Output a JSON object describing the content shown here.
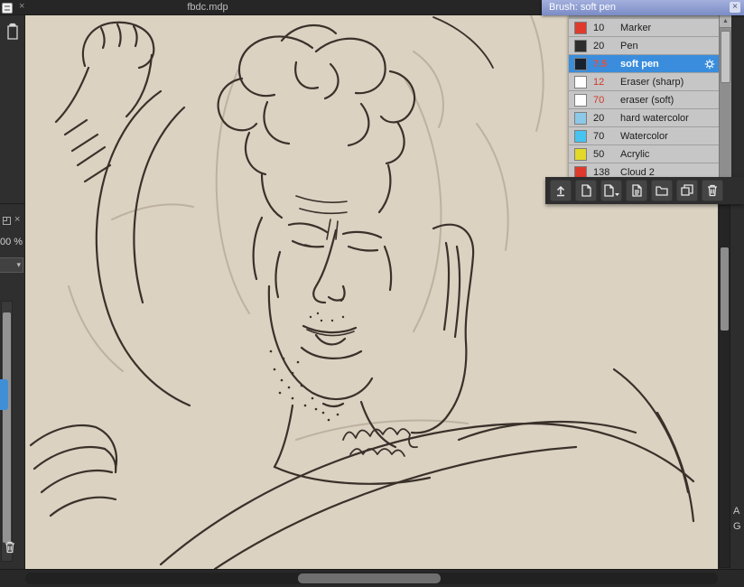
{
  "titlebar": {
    "title": "fbdc.mdp"
  },
  "left_panel": {
    "zoom": "00 %"
  },
  "brush_panel": {
    "title": "Brush: soft pen",
    "brushes": [
      {
        "size": "10",
        "name": "Marker",
        "swatch": "#e03a2c"
      },
      {
        "size": "20",
        "name": "Pen",
        "swatch": "#2d2d2d"
      },
      {
        "size": "7.5",
        "name": "soft pen",
        "swatch": "#18222e",
        "size_color": "#e8503a",
        "selected": true
      },
      {
        "size": "12",
        "name": "Eraser (sharp)",
        "swatch": "#ffffff",
        "size_color": "#cf3a28"
      },
      {
        "size": "70",
        "name": "eraser (soft)",
        "swatch": "#ffffff",
        "size_color": "#cf3a28"
      },
      {
        "size": "20",
        "name": "hard watercolor",
        "swatch": "#8cc9e8"
      },
      {
        "size": "70",
        "name": "Watercolor",
        "swatch": "#46c3f0"
      },
      {
        "size": "50",
        "name": "Acrylic",
        "swatch": "#e2d928"
      },
      {
        "size": "138",
        "name": "Cloud 2",
        "swatch": "#e03a2c"
      }
    ],
    "toolbar_icons": [
      "add-brush-upload",
      "new-brush",
      "new-brush-menu",
      "brush-properties",
      "brush-folder",
      "duplicate-brush",
      "delete-brush"
    ],
    "scroll_up_glyph": "▲"
  },
  "right_strip": {
    "label_a": "A",
    "label_g": "G"
  },
  "colors": {
    "selection_blue": "#3a8ddc",
    "canvas_beige": "#dbd2c2",
    "accent_red": "#cf3a28",
    "panel_header_blue": "#8194cc"
  },
  "glyphs": {
    "close": "×",
    "caret_down": "▾"
  }
}
